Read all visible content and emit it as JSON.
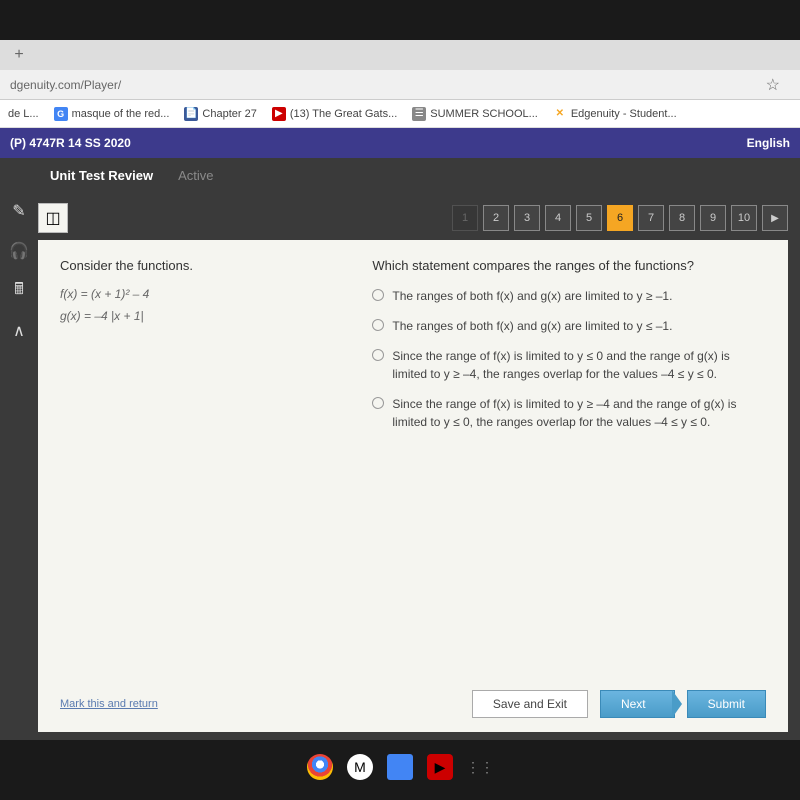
{
  "browser": {
    "url": "dgenuity.com/Player/",
    "bookmarks": [
      {
        "label": "de L...",
        "icon": ""
      },
      {
        "label": "masque of the red...",
        "icon": "G"
      },
      {
        "label": "Chapter 27",
        "icon": "📄"
      },
      {
        "label": "(13) The Great Gats...",
        "icon": "▶"
      },
      {
        "label": "SUMMER SCHOOL...",
        "icon": "☰"
      },
      {
        "label": "Edgenuity - Student...",
        "icon": "✕"
      }
    ]
  },
  "header": {
    "course": "(P) 4747R 14 SS 2020",
    "language": "English"
  },
  "title": {
    "main": "Unit Test Review",
    "status": "Active"
  },
  "nav": {
    "items": [
      "1",
      "2",
      "3",
      "4",
      "5",
      "6",
      "7",
      "8",
      "9",
      "10"
    ],
    "active": "6",
    "dim": "1"
  },
  "question": {
    "left_head": "Consider the functions.",
    "f1": "f(x) = (x + 1)² – 4",
    "f2": "g(x) = –4 |x + 1|",
    "right_head": "Which statement compares the ranges of the functions?",
    "options": [
      "The ranges of both f(x) and g(x) are limited to y ≥ –1.",
      "The ranges of both f(x) and g(x) are limited to y ≤ –1.",
      "Since the range of f(x) is limited to y ≤ 0 and the range of g(x) is limited to y ≥ –4, the ranges overlap for the values –4 ≤ y ≤ 0.",
      "Since the range of f(x) is limited to y ≥ –4 and the range of g(x) is limited to y ≤ 0, the ranges overlap for the values –4 ≤ y ≤ 0."
    ]
  },
  "footer": {
    "mark": "Mark this and return",
    "save": "Save and Exit",
    "next": "Next",
    "submit": "Submit"
  }
}
